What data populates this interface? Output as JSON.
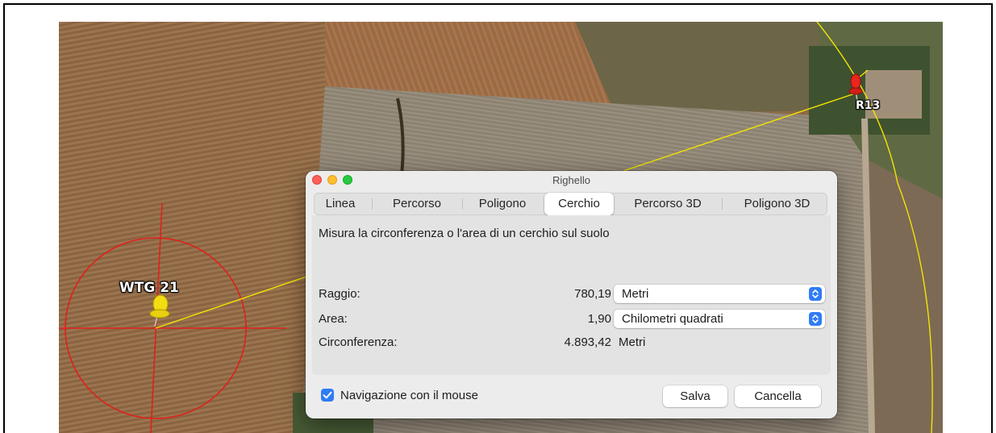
{
  "dialog": {
    "title": "Righello",
    "tabs": [
      {
        "label": "Linea",
        "active": false
      },
      {
        "label": "Percorso",
        "active": false
      },
      {
        "label": "Poligono",
        "active": false
      },
      {
        "label": "Cerchio",
        "active": true
      },
      {
        "label": "Percorso 3D",
        "active": false
      },
      {
        "label": "Poligono 3D",
        "active": false
      }
    ],
    "description": "Misura la circonferenza o l'area di un cerchio sul suolo",
    "radius": {
      "label": "Raggio:",
      "value": "780,19",
      "unit": "Metri"
    },
    "area": {
      "label": "Area:",
      "value": "1,90",
      "unit": "Chilometri quadrati"
    },
    "circumference": {
      "label": "Circonferenza:",
      "value": "4.893,42",
      "unit": "Metri"
    },
    "mouse_navigation": {
      "label": "Navigazione con il mouse",
      "checked": true
    },
    "save_label": "Salva",
    "cancel_label": "Cancella"
  },
  "map": {
    "placemarks": [
      {
        "label": "WTG 21",
        "color": "#f5e21a"
      },
      {
        "label": "R13",
        "color": "#e8261c"
      }
    ],
    "measure_circle_color": "#e0201b",
    "path_line_color": "#f4e400"
  },
  "colors": {
    "accent": "#2f7cf6",
    "close": "#ff5f57",
    "minimize": "#febc2e",
    "zoom": "#28c840"
  }
}
